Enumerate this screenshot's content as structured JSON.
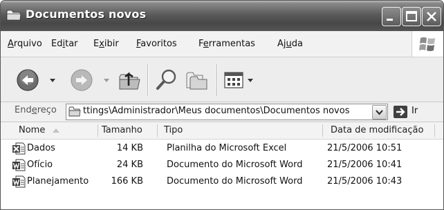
{
  "window": {
    "title": "Documentos novos"
  },
  "menu": {
    "items": [
      {
        "pre": "",
        "key": "A",
        "post": "rquivo"
      },
      {
        "pre": "Ed",
        "key": "i",
        "post": "tar"
      },
      {
        "pre": "E",
        "key": "x",
        "post": "ibir"
      },
      {
        "pre": "",
        "key": "F",
        "post": "avoritos"
      },
      {
        "pre": "F",
        "key": "e",
        "post": "rramentas"
      },
      {
        "pre": "Aj",
        "key": "u",
        "post": "da"
      }
    ]
  },
  "toolbar": {
    "icons": [
      "back-icon",
      "forward-icon",
      "up-folder-icon",
      "search-icon",
      "folders-icon",
      "views-icon"
    ]
  },
  "address": {
    "label_pre": "End",
    "label_key": "e",
    "label_post": "reço",
    "path": "ttings\\Administrador\\Meus documentos\\Documentos novos",
    "go_label": "Ir"
  },
  "columns": {
    "name": "Nome",
    "size": "Tamanho",
    "type": "Tipo",
    "modified": "Data de modificação"
  },
  "files": [
    {
      "name": "Dados",
      "size": "14 KB",
      "type": "Planilha do Microsoft Excel",
      "modified": "21/5/2006 10:51",
      "icon": "excel-file-icon"
    },
    {
      "name": "Ofício",
      "size": "24 KB",
      "type": "Documento do Microsoft Word",
      "modified": "21/5/2006 10:41",
      "icon": "word-file-icon"
    },
    {
      "name": "Planejamento",
      "size": "166 KB",
      "type": "Documento do Microsoft Word",
      "modified": "21/5/2006 10:43",
      "icon": "word-file-icon"
    }
  ]
}
